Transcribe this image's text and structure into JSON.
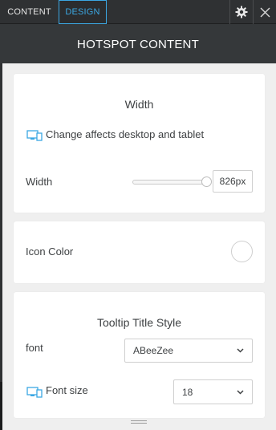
{
  "tabs": {
    "content": "CONTENT",
    "design": "DESIGN"
  },
  "header": {
    "title": "HOTSPOT CONTENT"
  },
  "width_card": {
    "title": "Width",
    "note": "Change affects desktop and tablet",
    "width_label": "Width",
    "width_value": "826px"
  },
  "icon_color_card": {
    "label": "Icon Color"
  },
  "tooltip_card": {
    "title": "Tooltip Title Style",
    "font_label": "font",
    "font_value": "ABeeZee",
    "font_size_label": "Font size",
    "font_size_value": "18"
  },
  "colors": {
    "accent": "#3ba7e3",
    "header_bg": "#35383a",
    "panel_bg": "#efefef"
  },
  "icons": [
    "gear-icon",
    "close-icon",
    "device-icon",
    "chevron-down-icon",
    "drag-handle-icon"
  ]
}
